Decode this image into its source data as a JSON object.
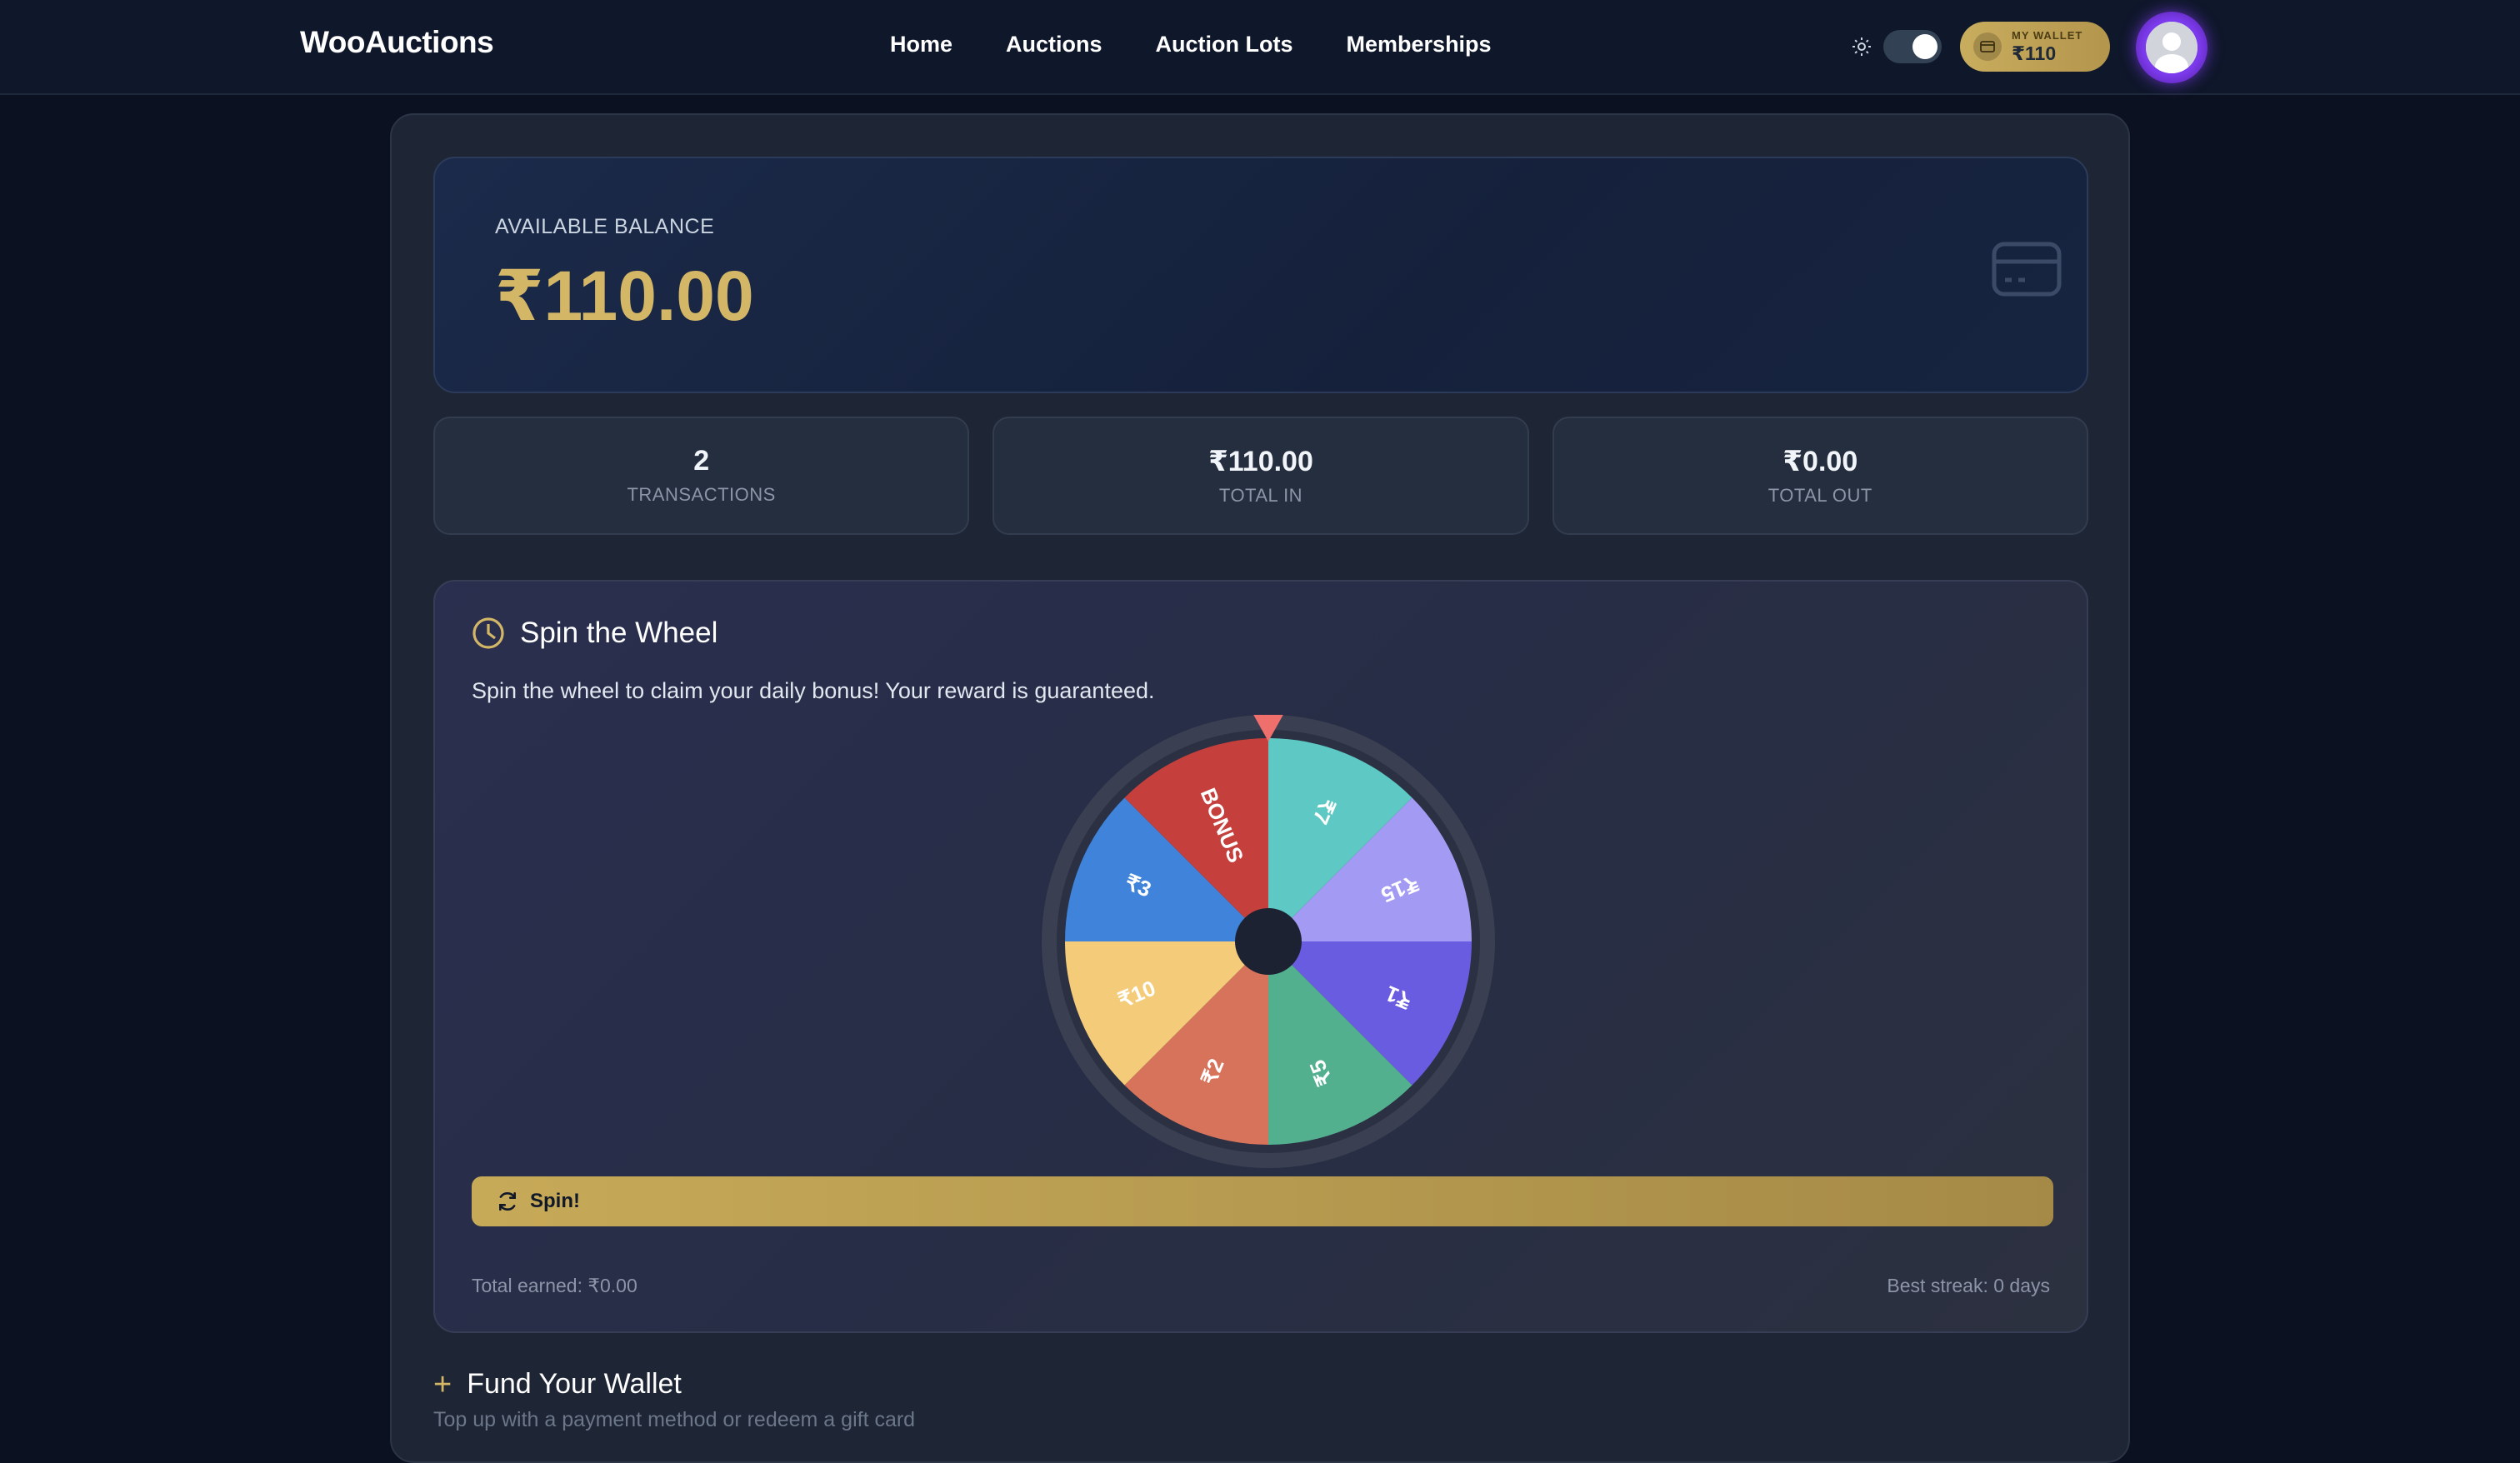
{
  "header": {
    "brand": "WooAuctions",
    "nav": [
      "Home",
      "Auctions",
      "Auction Lots",
      "Memberships"
    ],
    "wallet_label": "MY WALLET",
    "wallet_value": "₹110"
  },
  "balance": {
    "label": "AVAILABLE BALANCE",
    "value": "₹110.00"
  },
  "stats": [
    {
      "value": "2",
      "label": "TRANSACTIONS"
    },
    {
      "value": "₹110.00",
      "label": "TOTAL IN"
    },
    {
      "value": "₹0.00",
      "label": "TOTAL OUT"
    }
  ],
  "spin": {
    "title": "Spin the Wheel",
    "description": "Spin the wheel to claim your daily bonus! Your reward is guaranteed.",
    "button_label": "Spin!",
    "total_earned": "Total earned: ₹0.00",
    "best_streak": "Best streak: 0 days",
    "segments": [
      {
        "label": "₹7",
        "color": "#5ec8c4"
      },
      {
        "label": "₹15",
        "color": "#a39af3"
      },
      {
        "label": "₹1",
        "color": "#6a5ce0"
      },
      {
        "label": "₹5",
        "color": "#53b08f"
      },
      {
        "label": "₹2",
        "color": "#d8735b"
      },
      {
        "label": "₹10",
        "color": "#f4cb79"
      },
      {
        "label": "₹3",
        "color": "#3f83db"
      },
      {
        "label": "BONUS",
        "color": "#c53f3c"
      }
    ]
  },
  "fund": {
    "title": "Fund Your Wallet",
    "subtitle": "Top up with a payment method or redeem a gift card"
  },
  "colors": {
    "accent_gold": "#d4b766",
    "background": "#0b1120",
    "pointer": "#ef6f6c"
  }
}
